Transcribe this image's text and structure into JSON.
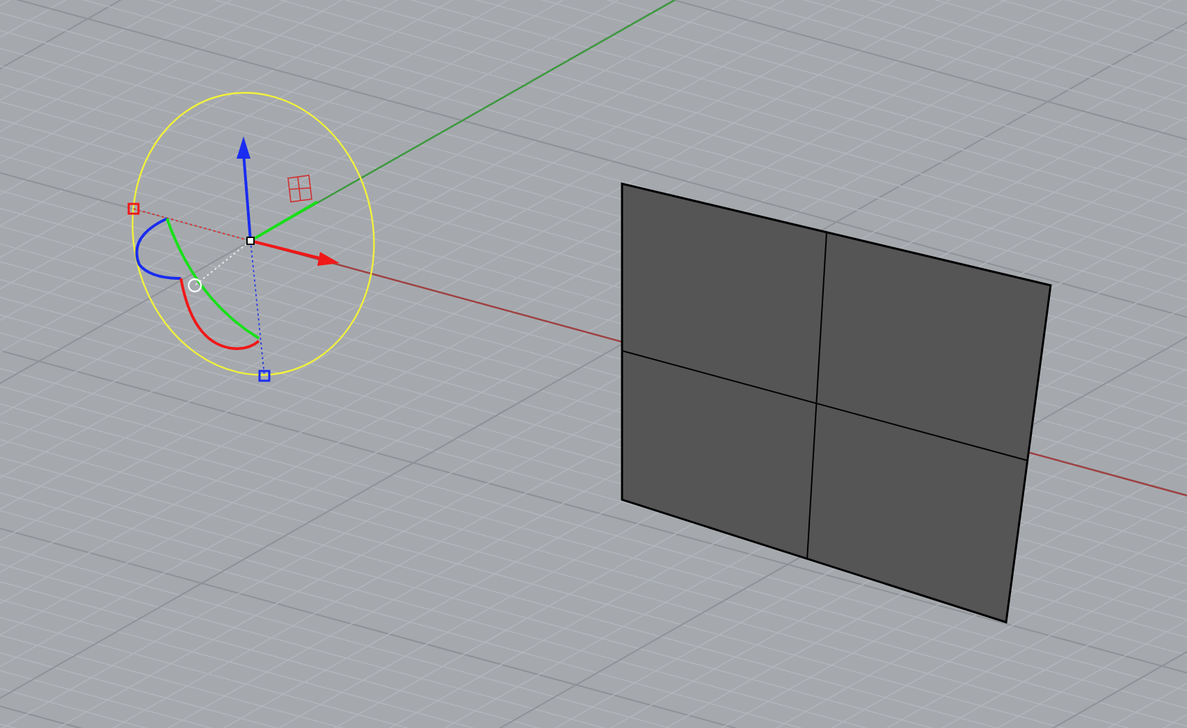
{
  "viewport": {
    "gumball": {
      "shown": true
    },
    "surface": {
      "selected": false
    }
  }
}
